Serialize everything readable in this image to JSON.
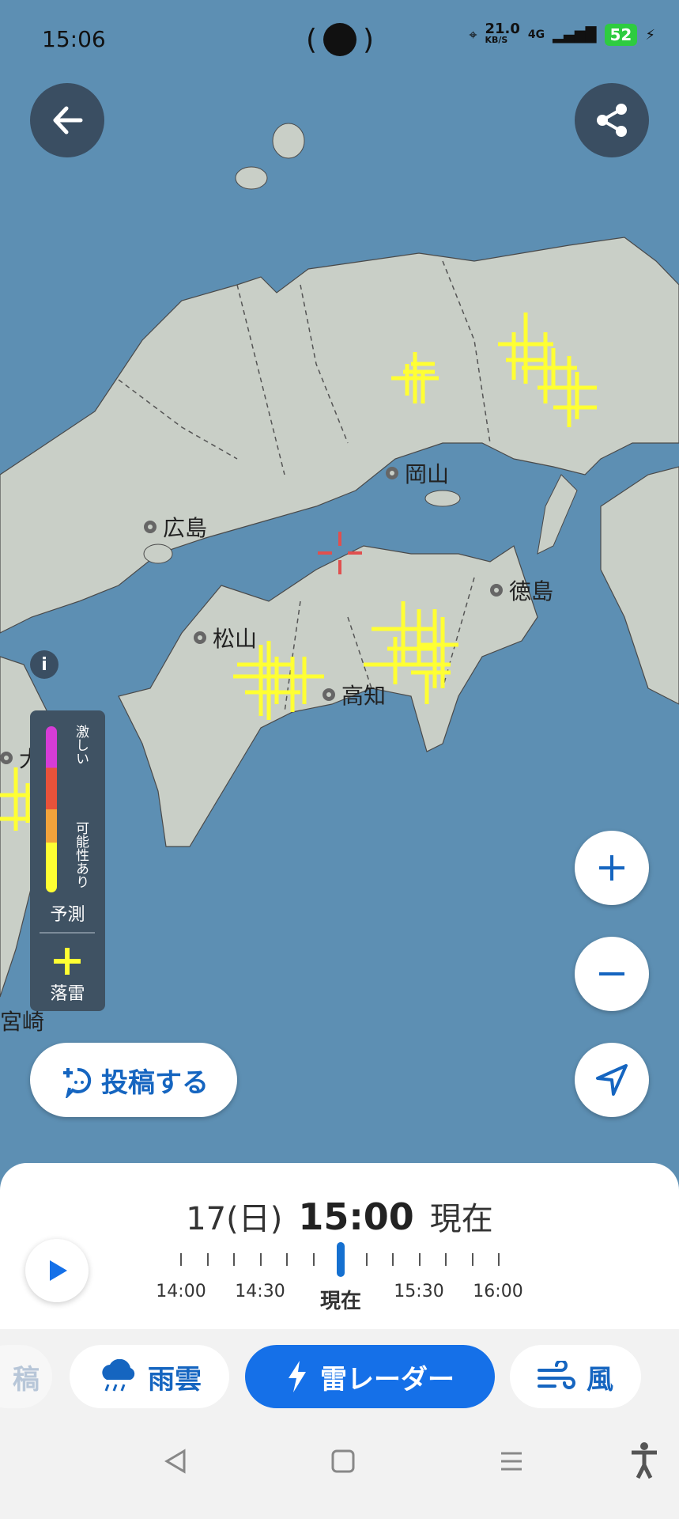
{
  "status_bar": {
    "time": "15:06",
    "speed": "21.0",
    "speed_unit": "KB/S",
    "network": "4G",
    "battery": "52"
  },
  "map": {
    "cities": [
      {
        "name": "岡山",
        "id": "okayama"
      },
      {
        "name": "広島",
        "id": "hiroshima"
      },
      {
        "name": "徳島",
        "id": "tokushima"
      },
      {
        "name": "松山",
        "id": "matsuyama"
      },
      {
        "name": "高知",
        "id": "kochi"
      },
      {
        "name": "大分",
        "id": "oita"
      },
      {
        "name": "宮崎",
        "id": "miyazaki"
      }
    ]
  },
  "legend": {
    "intense": "激しい",
    "possible": "可能性あり",
    "forecast": "予測",
    "strike": "落雷"
  },
  "actions": {
    "post": "投稿する"
  },
  "timeline": {
    "date": "17(日)",
    "time": "15:00",
    "now_suffix": "現在",
    "labels": [
      "14:00",
      "14:30",
      "現在",
      "15:30",
      "16:00"
    ]
  },
  "tabs": [
    {
      "label": "稿"
    },
    {
      "label": "雨雲"
    },
    {
      "label": "雷レーダー"
    },
    {
      "label": "風"
    }
  ],
  "colors": {
    "sea": "#5d8fb3",
    "land": "#c9cfc7",
    "lightning": "#ffff33",
    "accent": "#1570e8"
  }
}
